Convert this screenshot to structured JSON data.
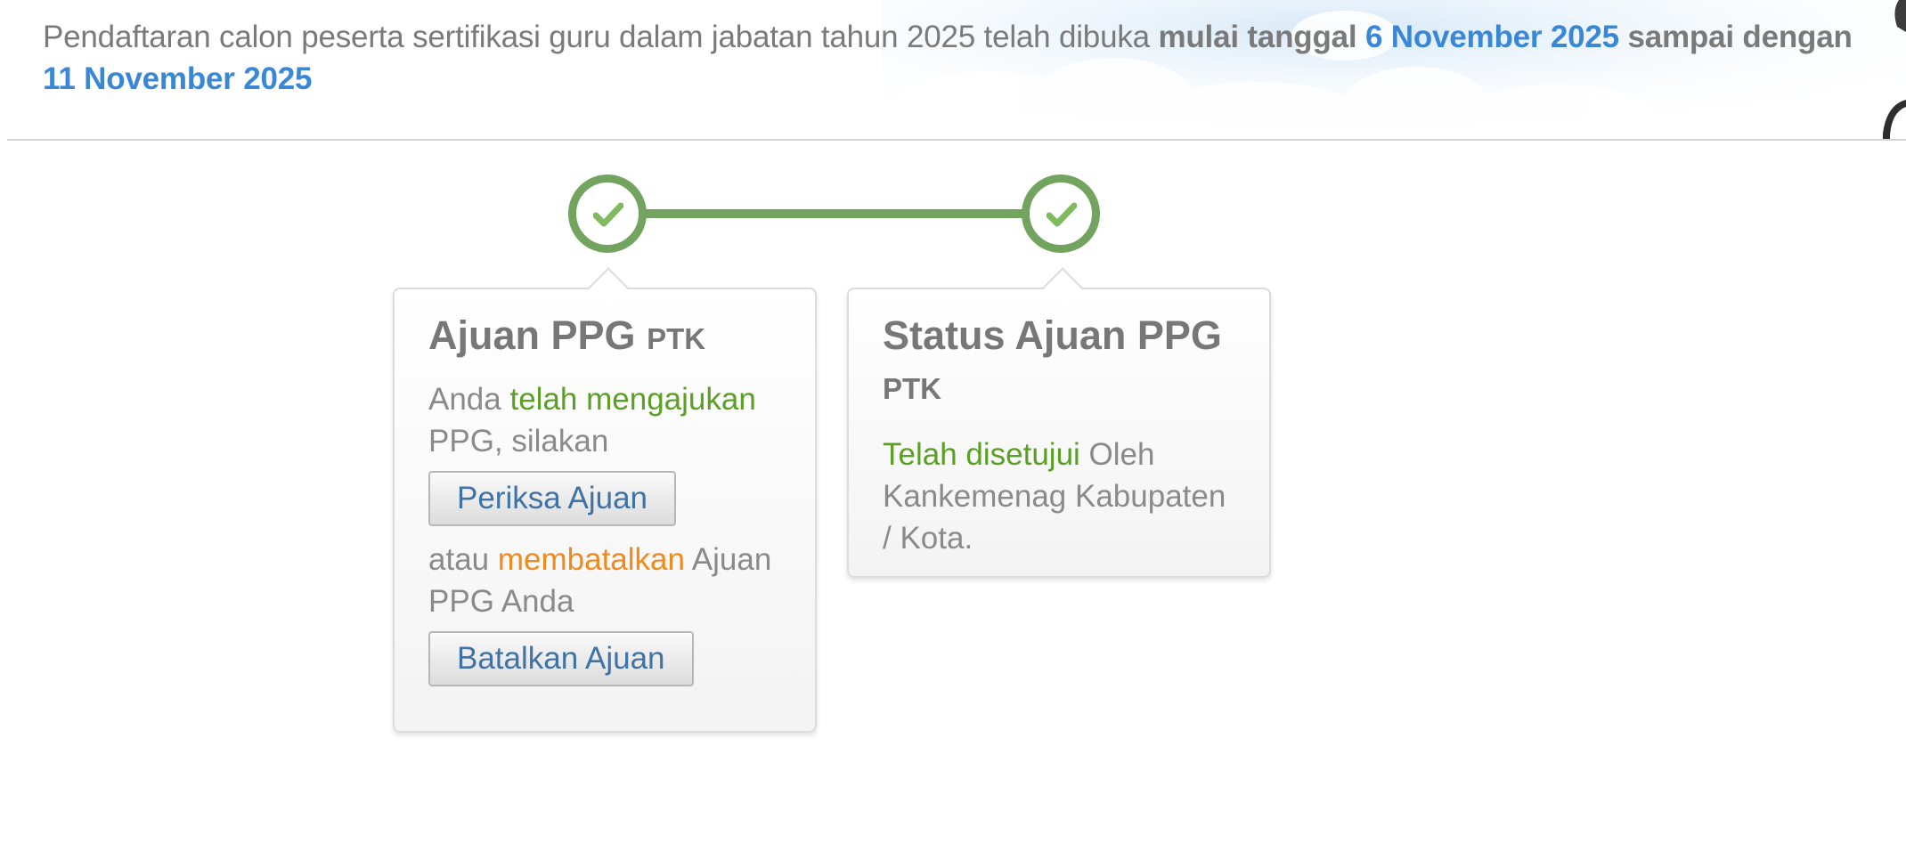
{
  "announcement": {
    "text_prefix": "Pendaftaran calon peserta sertifikasi guru dalam jabatan tahun 2025 telah dibuka",
    "text_mulai": "mulai tanggal",
    "start_date": "6 November 2025",
    "text_sampai": "sampai dengan",
    "end_date": "11 November 2025"
  },
  "stepper": {
    "steps": [
      {
        "status": "completed",
        "icon": "check-icon"
      },
      {
        "status": "completed",
        "icon": "check-icon"
      }
    ],
    "color": "#72a35f"
  },
  "cards": {
    "ajuan": {
      "title": "Ajuan PPG",
      "title_sub": "PTK",
      "text_1_before": "Anda",
      "text_1_highlight": "telah mengajukan",
      "text_1_after": "PPG, silakan",
      "check_button": "Periksa Ajuan",
      "text_2_before": "atau",
      "text_2_highlight": "membatalkan",
      "text_2_after": "Ajuan PPG Anda",
      "cancel_button": "Batalkan Ajuan"
    },
    "status": {
      "title": "Status Ajuan PPG",
      "title_sub": "PTK",
      "text_highlight": "Telah disetujui",
      "text_after": "Oleh Kankemenag Kabupaten / Kota."
    }
  },
  "colors": {
    "accent_blue": "#3a87d6",
    "success_green": "#5aa024",
    "warning_orange": "#ef8a1e",
    "button_text": "#3f73a5"
  }
}
